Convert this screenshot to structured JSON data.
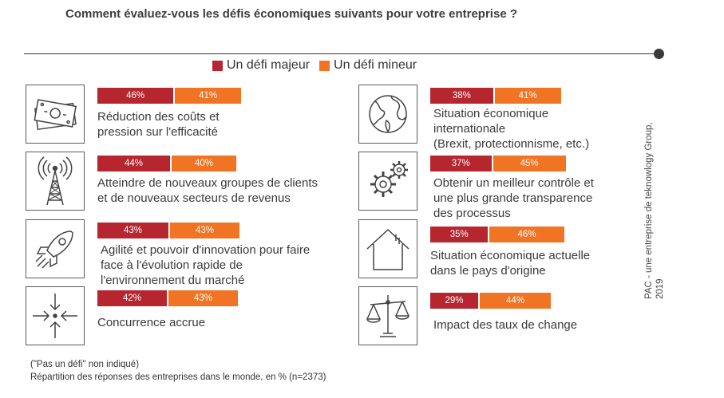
{
  "title": "Comment évaluez-vous les défis économiques suivants pour votre entreprise ?",
  "legend": [
    {
      "label": "Un défi majeur",
      "color": "#b5262f"
    },
    {
      "label": "Un défi mineur",
      "color": "#f07424"
    }
  ],
  "icons": [
    "money-icon",
    "antenna-icon",
    "rocket-icon",
    "compress-arrows-icon",
    "globe-icon",
    "gears-icon",
    "house-icon",
    "scale-icon"
  ],
  "chart_data": {
    "type": "bar",
    "stacked": true,
    "orientation": "horizontal",
    "title": "Comment évaluez-vous les défis économiques suivants pour votre entreprise ?",
    "categories": [
      "Réduction des coûts et pression sur l'efficacité",
      "Atteindre de nouveaux groupes de clients et de nouveaux secteurs de revenus",
      "Agilité et pouvoir d'innovation pour faire face à l'évolution rapide de l'environnement du marché",
      "Concurrence accrue",
      "Situation économique internationale (Brexit, protectionnisme, etc.)",
      "Obtenir un meilleur contrôle et une plus grande transparence des processus",
      "Situation économique actuelle dans le pays d'origine",
      "Impact des taux de change"
    ],
    "series": [
      {
        "name": "Un défi majeur",
        "color": "#b5262f",
        "values": [
          46,
          44,
          43,
          42,
          38,
          37,
          35,
          29
        ]
      },
      {
        "name": "Un défi mineur",
        "color": "#f07424",
        "values": [
          41,
          40,
          43,
          43,
          41,
          45,
          46,
          44
        ]
      }
    ],
    "items": [
      {
        "label_lines": [
          "Réduction des coûts et",
          "pression sur l'efficacité"
        ],
        "labels": [
          "46%",
          "41%"
        ]
      },
      {
        "label_lines": [
          "Atteindre de nouveaux groupes de clients",
          "et de nouveaux secteurs de revenus"
        ],
        "labels": [
          "44%",
          "40%"
        ]
      },
      {
        "label_lines": [
          "Agilité et pouvoir d'innovation pour faire",
          "face à l'évolution rapide de",
          "l'environnement du marché"
        ],
        "labels": [
          "43%",
          "43%"
        ]
      },
      {
        "label_lines": [
          "Concurrence accrue"
        ],
        "labels": [
          "42%",
          "43%"
        ]
      },
      {
        "label_lines": [
          "Situation économique",
          "internationale",
          "(Brexit, protectionnisme, etc.)"
        ],
        "labels": [
          "38%",
          "41%"
        ]
      },
      {
        "label_lines": [
          "Obtenir un meilleur contrôle et",
          "une plus grande transparence",
          "des processus"
        ],
        "labels": [
          "37%",
          "45%"
        ]
      },
      {
        "label_lines": [
          "Situation économique actuelle",
          "dans le pays d'origine"
        ],
        "labels": [
          "35%",
          "46%"
        ]
      },
      {
        "label_lines": [
          "Impact des taux de change"
        ],
        "labels": [
          "29%",
          "44%"
        ]
      }
    ],
    "unit": "%",
    "legend_position": "top-center"
  },
  "footnote": "(\"Pas un défi\" non indiqué)",
  "caption": "Répartition des réponses des entreprises dans le monde, en % (n=2373)",
  "source_lines": [
    "PAC - une entreprise de teknowlogy Group,",
    "2019"
  ]
}
